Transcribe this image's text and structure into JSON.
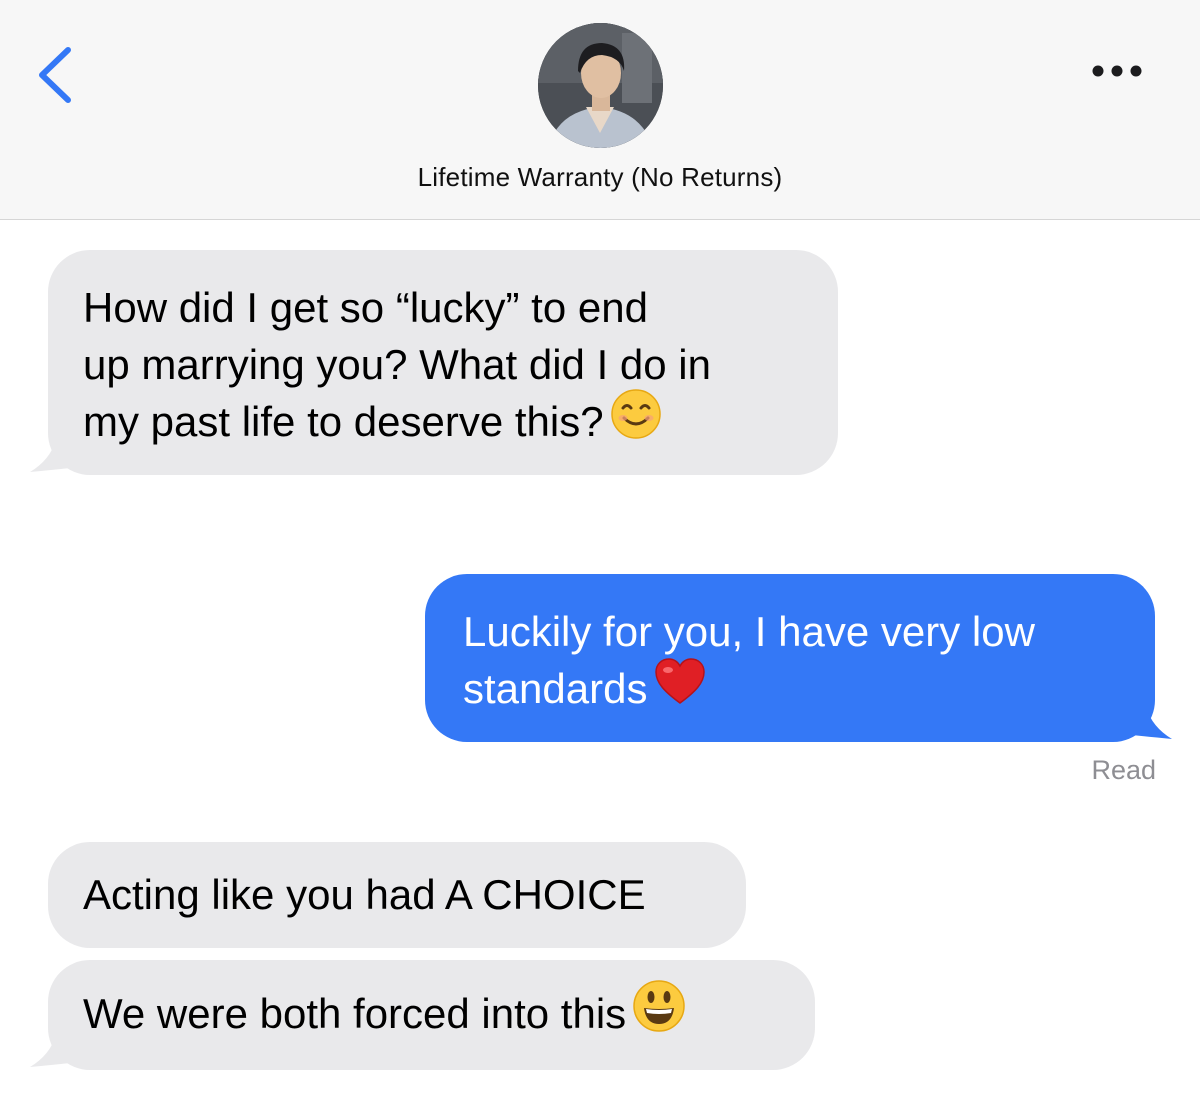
{
  "header": {
    "contact_name": "Lifetime Warranty (No Returns)",
    "back_icon": "chevron-left-icon",
    "more_icon": "ellipsis-icon",
    "accent_color": "#3478f6"
  },
  "messages": [
    {
      "direction": "incoming",
      "text": "How did I get so “lucky” to end\nup marrying you? What did I do in\nmy past life to deserve this?",
      "emoji": "smiling-face-with-smiling-eyes"
    },
    {
      "direction": "outgoing",
      "text": "Luckily for you, I have very low\nstandards",
      "emoji": "red-heart"
    },
    {
      "direction": "incoming",
      "text": "Acting like you had A CHOICE",
      "emoji": ""
    },
    {
      "direction": "incoming",
      "text": "We were both forced into this",
      "emoji": "grinning-face-with-big-eyes"
    }
  ],
  "read_receipt": "Read",
  "colors": {
    "incoming_bubble": "#e9e9eb",
    "outgoing_bubble": "#3478f6",
    "header_bg": "#f7f7f7"
  }
}
